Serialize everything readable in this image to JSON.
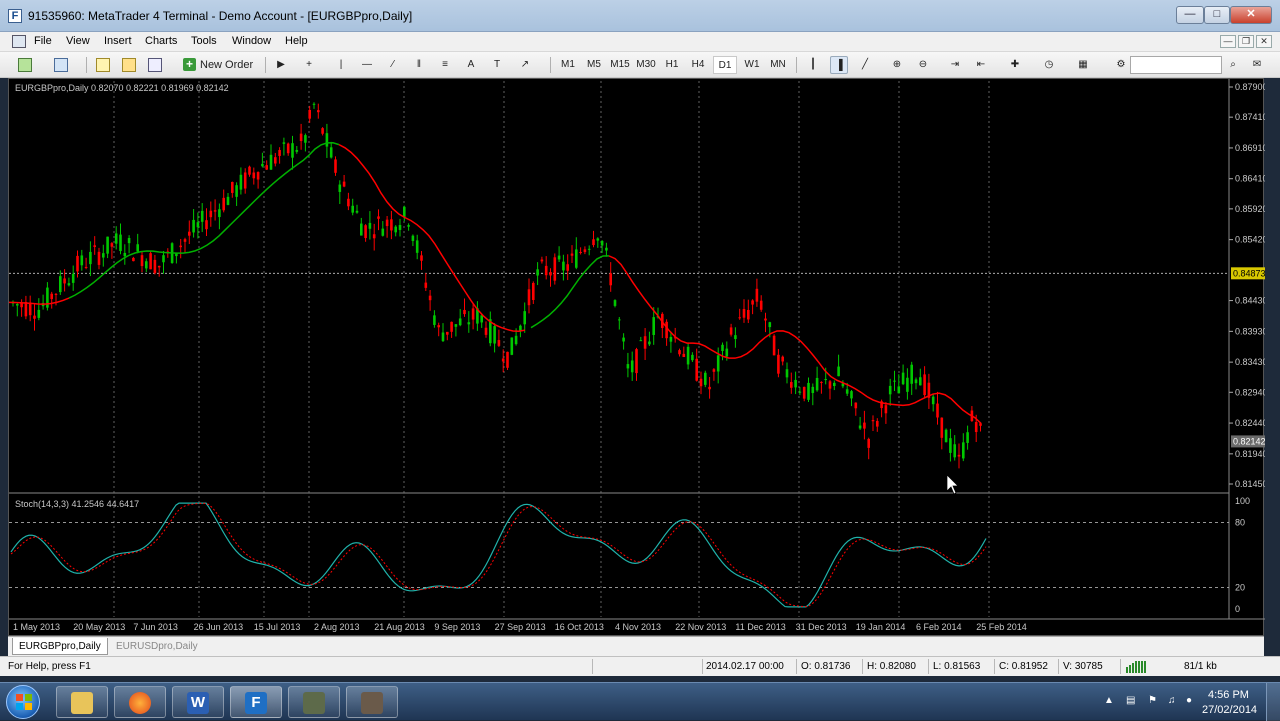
{
  "window": {
    "title": "91535960: MetaTrader 4 Terminal - Demo Account - [EURGBPpro,Daily]",
    "app_icon": "F"
  },
  "menu": [
    "File",
    "View",
    "Insert",
    "Charts",
    "Tools",
    "Window",
    "Help"
  ],
  "toolbar": {
    "new_order": "New Order",
    "timeframes": [
      "M1",
      "M5",
      "M15",
      "M30",
      "H1",
      "H4",
      "D1",
      "W1",
      "MN"
    ],
    "active_timeframe": "D1"
  },
  "chart": {
    "symbol_info": "EURGBPpro,Daily  0.82070 0.82221 0.81969 0.82142",
    "stoch_info": "Stoch(14,3,3) 41.2546 44.6417",
    "price_labels": [
      "0.87900",
      "0.87410",
      "0.86910",
      "0.86410",
      "0.85920",
      "0.85420",
      "0.84430",
      "0.83930",
      "0.83430",
      "0.82940",
      "0.82440",
      "0.81940",
      "0.81450"
    ],
    "current_bid_label": "0.84873",
    "current_price_label": "0.82142",
    "stoch_levels": [
      "100",
      "80",
      "20",
      "0"
    ],
    "date_labels": [
      "1 May 2013",
      "20 May 2013",
      "7 Jun 2013",
      "26 Jun 2013",
      "15 Jul 2013",
      "2 Aug 2013",
      "21 Aug 2013",
      "9 Sep 2013",
      "27 Sep 2013",
      "16 Oct 2013",
      "4 Nov 2013",
      "22 Nov 2013",
      "11 Dec 2013",
      "31 Dec 2013",
      "19 Jan 2014",
      "6 Feb 2014",
      "25 Feb 2014"
    ],
    "colors": {
      "background": "#000000",
      "bull": "#00c800",
      "bear": "#ff0000",
      "ma_red": "#ff0000",
      "ma_green": "#00b000",
      "stoch_main": "#20b2aa",
      "stoch_signal": "#ff0000",
      "grid": "#7a7a7a"
    }
  },
  "tabs": [
    "EURGBPpro,Daily",
    "EURUSDpro,Daily"
  ],
  "active_tab": "EURGBPpro,Daily",
  "status": {
    "help": "For Help, press F1",
    "datetime": "2014.02.17 00:00",
    "open": "O: 0.81736",
    "high": "H: 0.82080",
    "low": "L: 0.81563",
    "close": "C: 0.81952",
    "volume": "V: 30785",
    "traffic": "81/1 kb"
  },
  "taskbar": {
    "apps": [
      "explorer-icon",
      "firefox-icon",
      "word-icon",
      "metatrader-icon",
      "terminal-icon-1",
      "terminal-icon-2"
    ],
    "time": "4:56 PM",
    "date": "27/02/2014"
  }
}
